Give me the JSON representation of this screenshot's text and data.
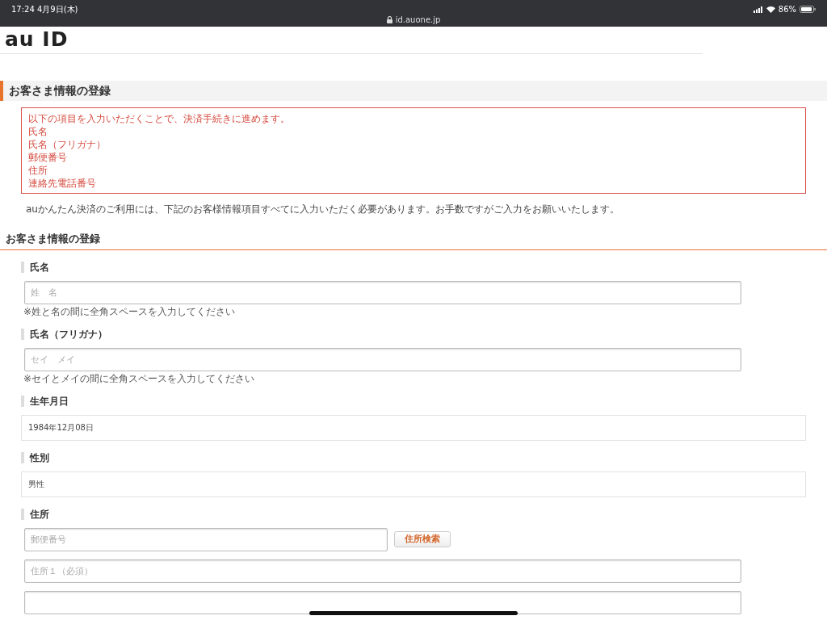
{
  "status_bar": {
    "time": "17:24",
    "date": "4月9日(木)",
    "url": "id.auone.jp",
    "battery": "86%"
  },
  "logo": "au ID",
  "section_title": "お客さま情報の登録",
  "alert": {
    "lines": [
      "以下の項目を入力いただくことで、決済手続きに進めます。",
      "氏名",
      "氏名（フリガナ）",
      "郵便番号",
      "住所",
      "連絡先電話番号"
    ]
  },
  "intro": "auかんたん決済のご利用には、下記のお客様情報項目すべてに入力いただく必要があります。お手数ですがご入力をお願いいたします。",
  "form_title": "お客さま情報の登録",
  "fields": [
    {
      "kind": "input",
      "label": "氏名",
      "placeholder": "姓　名",
      "note": "※姓と名の間に全角スペースを入力してください"
    },
    {
      "kind": "input",
      "label": "氏名（フリガナ）",
      "placeholder": "セイ　メイ",
      "note": "※セイとメイの間に全角スペースを入力してください"
    },
    {
      "kind": "static",
      "label": "生年月日",
      "value": "1984年12月08日"
    },
    {
      "kind": "static",
      "label": "性別",
      "value": "男性"
    },
    {
      "kind": "address",
      "label": "住所",
      "postal_placeholder": "郵便番号",
      "search_button": "住所検索",
      "address1_placeholder": "住所１（必須）"
    }
  ]
}
